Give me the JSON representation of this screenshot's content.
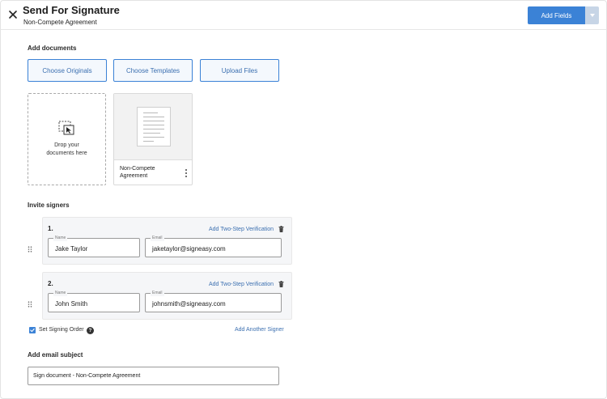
{
  "header": {
    "title": "Send For Signature",
    "subtitle": "Non-Compete Agreement",
    "add_fields_label": "Add Fields"
  },
  "documents": {
    "section_label": "Add documents",
    "buttons": [
      {
        "label": "Choose Originals"
      },
      {
        "label": "Choose Templates"
      },
      {
        "label": "Upload Files"
      }
    ],
    "dropzone_line1": "Drop your",
    "dropzone_line2": "documents here",
    "card": {
      "name": "Non-Compete Agreement"
    }
  },
  "signers": {
    "section_label": "Invite signers",
    "two_step_label": "Add Two-Step Verification",
    "name_label": "Name",
    "email_label": "Email",
    "list": [
      {
        "number": "1.",
        "name": "Jake Taylor",
        "email": "jaketaylor@signeasy.com"
      },
      {
        "number": "2.",
        "name": "John Smith",
        "email": "johnsmith@signeasy.com"
      }
    ],
    "signing_order_label": "Set Signing Order",
    "signing_order_checked": true,
    "help_glyph": "?",
    "add_another_label": "Add Another Signer"
  },
  "email": {
    "section_label": "Add email subject",
    "subject_value": "Sign document - Non-Compete Agreement"
  },
  "colors": {
    "accent": "#3b82d6",
    "link": "#3b6fb0",
    "card_bg": "#f5f6f8"
  },
  "icons": {
    "close": "close-icon",
    "caret": "chevron-down-icon",
    "dropzone": "drop-cursor-icon",
    "menu": "more-vertical-icon",
    "trash": "trash-icon",
    "drag": "drag-handle-icon",
    "help": "help-icon",
    "check": "check-icon"
  }
}
